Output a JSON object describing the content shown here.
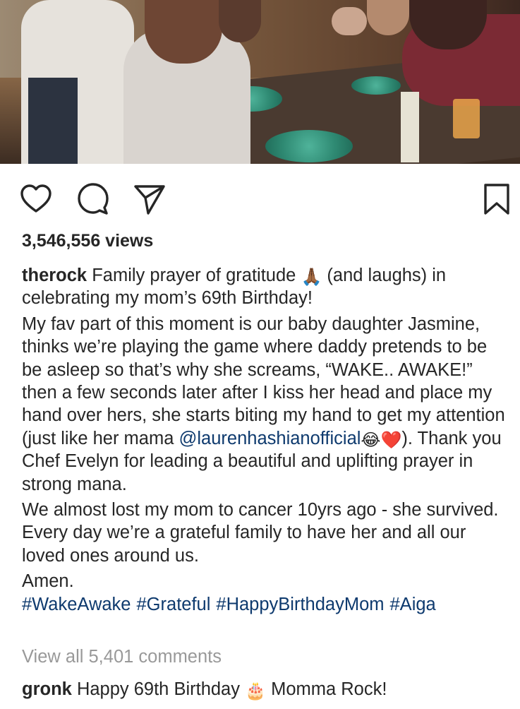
{
  "post": {
    "views": "3,546,556 views",
    "caption": {
      "username": "therock",
      "line1_before_emoji": "Family prayer of gratitude",
      "line1_emoji": "🙏🏾",
      "line1_after_emoji": "(and laughs) in celebrating my mom’s 69th Birthday!",
      "para2_before_mention": "My fav part of this moment is our baby daughter Jasmine, thinks we’re playing the game where daddy pretends to be be asleep so that’s why she screams, “WAKE.. AWAKE!” then a few seconds later after I kiss her head and place my hand over hers, she starts biting my hand to get my attention (just like her mama",
      "mention": "@laurenhashianofficial",
      "para2_emojis": "😂❤️",
      "para2_after_mention": "). Thank you Chef Evelyn for leading a beautiful and uplifting prayer in strong mana.",
      "para3": "We almost lost my mom to cancer 10yrs ago - she survived. Every day we’re a grateful family to have her and all our loved ones around us.",
      "para4": "Amen.",
      "hashtags": [
        "#WakeAwake",
        "#Grateful",
        "#HappyBirthdayMom",
        "#Aiga"
      ]
    },
    "view_all_comments": "View all 5,401 comments",
    "top_comment": {
      "username": "gronk",
      "text_before_emoji": "Happy 69th Birthday",
      "emoji": "🎂",
      "text_after_emoji": "Momma Rock!"
    }
  },
  "icons": {
    "like": "heart-icon",
    "comment": "comment-bubble-icon",
    "share": "paper-plane-icon",
    "save": "bookmark-icon"
  }
}
